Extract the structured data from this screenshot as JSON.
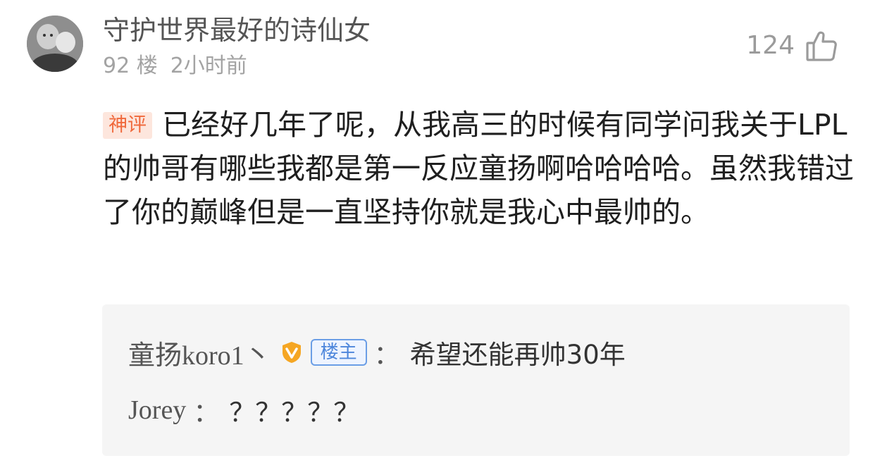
{
  "comment": {
    "username": "守护世界最好的诗仙女",
    "floor": "92 楼",
    "time": "2小时前",
    "like_count": "124",
    "badge": "神评",
    "text": "已经好几年了呢，从我高三的时候有同学问我关于LPL的帅哥有哪些我都是第一反应童扬啊哈哈哈哈。虽然我错过了你的巅峰但是一直坚持你就是我心中最帅的。"
  },
  "replies": [
    {
      "author": "童扬koro1丶",
      "verified_icon": "v-badge-icon",
      "host_label": "楼主",
      "separator": "：",
      "text": "希望还能再帅30年"
    },
    {
      "author": "Jorey",
      "separator": "：",
      "text": "？？？？？"
    }
  ],
  "colors": {
    "badge_bg": "#fde6dd",
    "badge_text": "#f0693c",
    "host_badge": "#4d86db",
    "verified": "#f5a623"
  }
}
